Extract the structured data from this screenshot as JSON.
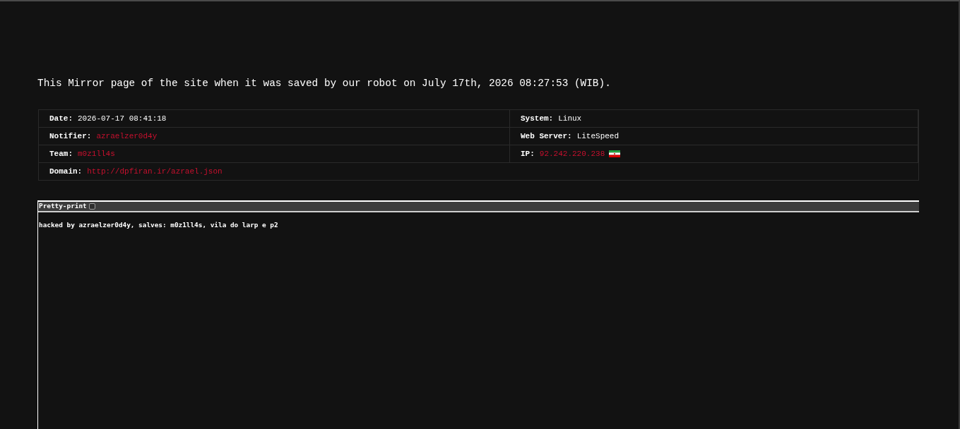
{
  "heading": "This Mirror page of the site when it was saved by our robot on July 17th, 2026 08:27:53 (WIB).",
  "info": {
    "rows": [
      {
        "cells": [
          {
            "label": "Date:",
            "value": "2026-07-17 08:41:18",
            "kind": "text"
          },
          {
            "label": "System:",
            "value": "Linux",
            "kind": "text"
          }
        ]
      },
      {
        "cells": [
          {
            "label": "Notifier:",
            "value": "azraelzer0d4y",
            "kind": "link"
          },
          {
            "label": "Web Server:",
            "value": "LiteSpeed",
            "kind": "text"
          }
        ]
      },
      {
        "cells": [
          {
            "label": "Team:",
            "value": "m0z1ll4s",
            "kind": "link"
          },
          {
            "label": "IP:",
            "value": "92.242.220.238",
            "kind": "ip"
          }
        ]
      },
      {
        "cells": [
          {
            "label": "Domain:",
            "value": "http://dpfiran.ir/azrael.json",
            "kind": "link"
          }
        ]
      }
    ]
  },
  "viewer": {
    "toolbar": {
      "label": "Pretty-print",
      "checked": false
    },
    "content": "hacked by azraelzer0d4y, salves: m0z1ll4s, vila do larp e p2"
  }
}
